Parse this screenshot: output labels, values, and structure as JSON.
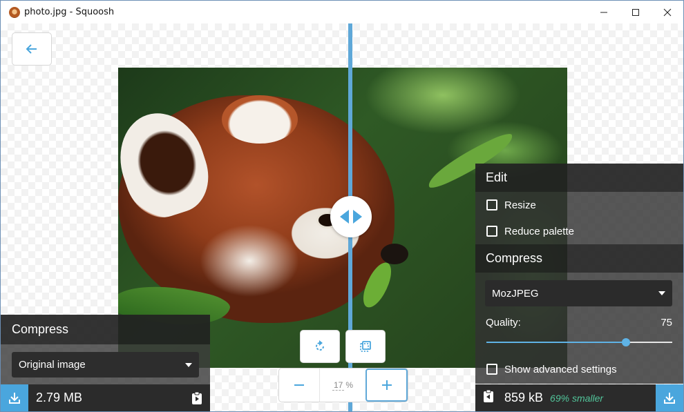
{
  "window": {
    "title": "photo.jpg - Squoosh",
    "controls": [
      "minimize",
      "maximize",
      "close"
    ]
  },
  "left_panel": {
    "heading": "Compress",
    "method": "Original image",
    "size": "2.79 MB"
  },
  "right_panel": {
    "edit_heading": "Edit",
    "resize_label": "Resize",
    "reduce_palette_label": "Reduce palette",
    "compress_heading": "Compress",
    "codec": "MozJPEG",
    "quality_label": "Quality:",
    "quality_value": "75",
    "quality_fraction": 0.75,
    "advanced_label": "Show advanced settings",
    "size": "859 kB",
    "savings": "69% smaller"
  },
  "zoom": {
    "value": "17",
    "unit": "%"
  },
  "colors": {
    "accent": "#5fa8d8",
    "savings": "#52c59b"
  }
}
